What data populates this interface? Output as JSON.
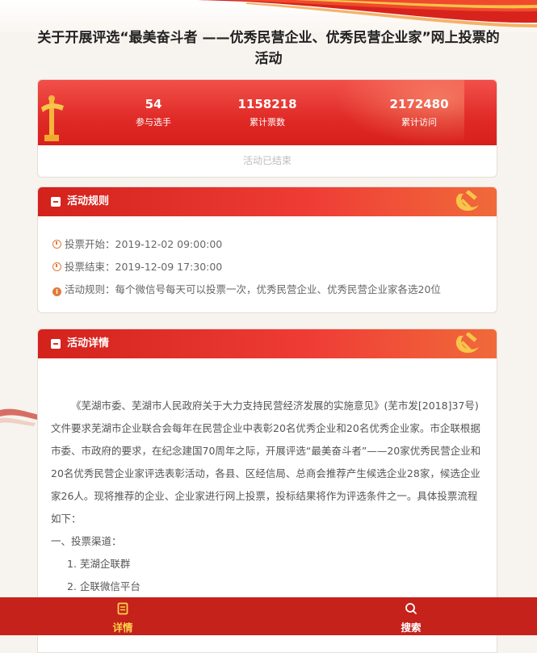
{
  "page": {
    "title": "关于开展评选“最美奋斗者 ——优秀民营企业、优秀民营企业家”网上投票的活动"
  },
  "stats": {
    "participants": {
      "value": "54",
      "label": "参与选手"
    },
    "votes": {
      "value": "1158218",
      "label": "累计票数"
    },
    "visits": {
      "value": "2172480",
      "label": "累计访问"
    },
    "status": "活动已结束"
  },
  "rules": {
    "title": "活动规则",
    "start": "投票开始：2019-12-02 09:00:00",
    "end": "投票结束：2019-12-09 17:30:00",
    "rule": "活动规则：每个微信号每天可以投票一次，优秀民营企业、优秀民营企业家各选20位"
  },
  "detail": {
    "title": "活动详情",
    "paragraph": "《芜湖市委、芜湖市人民政府关于大力支持民营经济发展的实施意见》(芜市发[2018]37号)文件要求芜湖市企业联合会每年在民营企业中表彰20名优秀企业和20名优秀企业家。市企联根据市委、市政府的要求，在纪念建国70周年之际，开展评选“最美奋斗者”——20家优秀民营企业和20名优秀民营企业家评选表彰活动，各县、区经信局、总商会推荐产生候选企业28家，候选企业家26人。现将推荐的企业、企业家进行网上投票，投标结果将作为评选条件之一。具体投票流程如下：",
    "section1": "一、投票渠道：",
    "item1": "1. 芜湖企联群",
    "item2": "2. 企联微信平台"
  },
  "tabbar": {
    "details_label": "详情",
    "search_label": "搜索"
  },
  "colors": {
    "primary_red": "#e02a26",
    "tabbar_red": "#c5221c",
    "active_tab": "#ffd34a",
    "icon_orange": "#e07b3a"
  },
  "icons": {
    "rules_header": "document-icon",
    "party_emblem": "hammer-sickle-icon",
    "clock": "clock-icon",
    "info": "info-icon",
    "details_tab": "document-icon",
    "search_tab": "search-icon"
  }
}
